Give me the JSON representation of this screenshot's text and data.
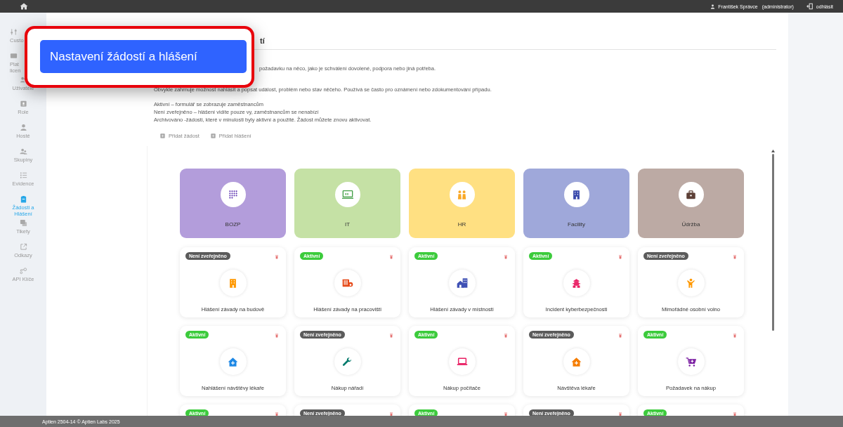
{
  "top_bar": {
    "user": "František Správce",
    "role": "(administrator)",
    "logout": "odhlásit"
  },
  "sidebar": {
    "items": [
      {
        "label": "Custo",
        "kind": "sliders",
        "selected": false
      },
      {
        "label": "Plat licen",
        "kind": "card",
        "selected": false
      },
      {
        "label": "Uživatelé",
        "kind": "users",
        "selected": false
      },
      {
        "label": "Role",
        "kind": "idbadge",
        "selected": false
      },
      {
        "label": "Hosté",
        "kind": "person",
        "selected": false
      },
      {
        "label": "Skupiny",
        "kind": "group",
        "selected": false
      },
      {
        "label": "Evidence",
        "kind": "list",
        "selected": false
      },
      {
        "label": "Žádosti a Hlášení",
        "kind": "clipboard",
        "selected": true
      },
      {
        "label": "Tikety",
        "kind": "chat",
        "selected": false
      },
      {
        "label": "Odkazy",
        "kind": "extlink",
        "selected": false
      },
      {
        "label": "API Klíče",
        "kind": "key",
        "selected": false
      }
    ]
  },
  "callout": {
    "title": "Nastavení žádostí a hlášení"
  },
  "page": {
    "title": "tí",
    "description": [
      "požadavku na něco, jako je schválení dovolené, podpora nebo jiná potřeba.",
      "Obvykle zahrnuje možnost nahlásit a popsat událost, problém nebo stav něčeho. Používá se často pro oznámení nebo zdokumentování případu."
    ],
    "legend": [
      "Aktivní – formulář se zobrazuje zaměstnancům",
      "Není zveřejněno – hlášení vidíte pouze vy, zaměstnancům se nenabízí",
      "Archivováno  -žádosti, které v minulosti byly aktivní a použité. Žádost můžete znovu aktivovat."
    ],
    "actions": [
      "Přidat žádost",
      "Přidat hlášení"
    ]
  },
  "categories": [
    {
      "label": "BOZP",
      "color": "#b39ddb",
      "kind": "dots"
    },
    {
      "label": "IT",
      "color": "#c5e1a5",
      "kind": "monitor"
    },
    {
      "label": "HR",
      "color": "#ffe082",
      "kind": "people"
    },
    {
      "label": "Facility",
      "color": "#9fa8da",
      "kind": "building"
    },
    {
      "label": "Údržba",
      "color": "#bcaaa4",
      "kind": "briefcase"
    }
  ],
  "requests": [
    {
      "badge": {
        "label": "Není zveřejněno",
        "kind": "unpublished"
      },
      "label": "Hlášení závady na budově",
      "kind": "building",
      "color": "#ff9800"
    },
    {
      "badge": {
        "label": "Aktivní",
        "kind": "active"
      },
      "label": "Hlášení závady na pracovišti",
      "kind": "heater",
      "color": "#e64a19"
    },
    {
      "badge": {
        "label": "Aktivní",
        "kind": "active"
      },
      "label": "Hlášení závady v místnosti",
      "kind": "househouse",
      "color": "#3f51b5"
    },
    {
      "badge": {
        "label": "Aktivní",
        "kind": "active"
      },
      "label": "Incident kyberbezpečnosti",
      "kind": "pagoda",
      "color": "#e91e63"
    },
    {
      "badge": {
        "label": "Není zveřejněno",
        "kind": "unpublished"
      },
      "label": "Mimořádné osobní volno",
      "kind": "person",
      "color": "#ff9800"
    },
    {
      "badge": {
        "label": "Aktivní",
        "kind": "active"
      },
      "label": "Nahlášení návštěvy lékaře",
      "kind": "houseplus",
      "color": "#1e88e5"
    },
    {
      "badge": {
        "label": "Není zveřejněno",
        "kind": "unpublished"
      },
      "label": "Nákup nářadí",
      "kind": "wrench",
      "color": "#00796b"
    },
    {
      "badge": {
        "label": "Aktivní",
        "kind": "active"
      },
      "label": "Nákup počítače",
      "kind": "laptop",
      "color": "#e91e63"
    },
    {
      "badge": {
        "label": "Není zveřejněno",
        "kind": "unpublished"
      },
      "label": "Návštěva lékaře",
      "kind": "houseplus",
      "color": "#f57c00"
    },
    {
      "badge": {
        "label": "Aktivní",
        "kind": "active"
      },
      "label": "Požadavek na nákup",
      "kind": "cart",
      "color": "#7b1fa2"
    },
    {
      "badge": {
        "label": "Aktivní",
        "kind": "active"
      }
    },
    {
      "badge": {
        "label": "Není zveřejněno",
        "kind": "unpublished"
      }
    },
    {
      "badge": {
        "label": "Aktivní",
        "kind": "active"
      }
    },
    {
      "badge": {
        "label": "Není zveřejněno",
        "kind": "unpublished"
      }
    },
    {
      "badge": {
        "label": "Aktivní",
        "kind": "active"
      }
    }
  ],
  "footer": {
    "text": "Aptien 2504-14 © Aptien Labs 2025"
  }
}
